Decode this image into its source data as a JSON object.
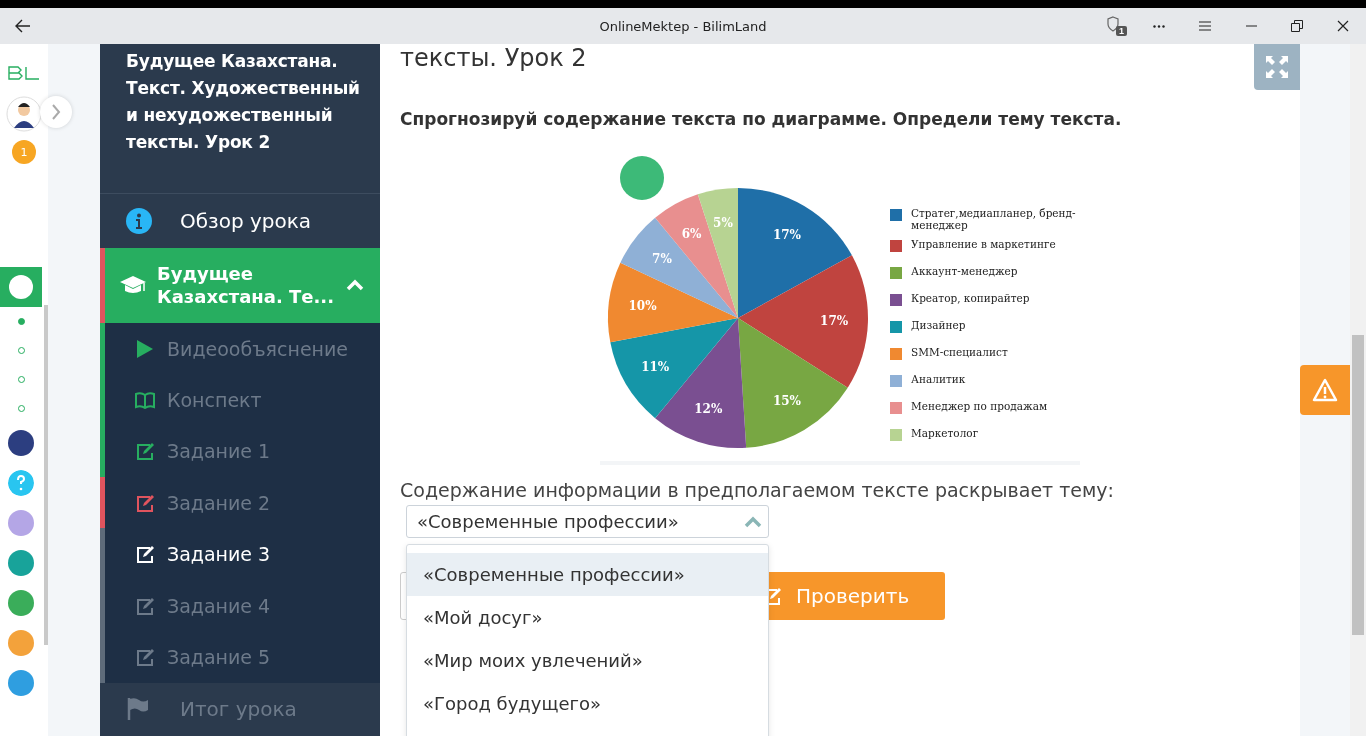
{
  "window": {
    "title": "OnlineMektep - BilimLand",
    "extension_badge": "1"
  },
  "rail": {
    "notification_count": "1",
    "lesson_dots": [
      {
        "selected": true
      },
      {
        "selected": false
      },
      {
        "selected": false
      },
      {
        "selected": false
      }
    ]
  },
  "sidebar": {
    "lesson_title": "Будущее Казахстана. Текст. Художественный и нехудожественный тексты. Урок 2",
    "overview": "Обзор урока",
    "section": {
      "title": "Будущее Казахстана. Те...",
      "expanded": true
    },
    "items": [
      {
        "label": "Видеообъяснение",
        "kind": "video",
        "done": true,
        "failed": false,
        "selected": false
      },
      {
        "label": "Конспект",
        "kind": "notes",
        "done": true,
        "failed": false,
        "selected": false
      },
      {
        "label": "Задание 1",
        "kind": "task",
        "done": true,
        "failed": false,
        "selected": false
      },
      {
        "label": "Задание 2",
        "kind": "task",
        "done": false,
        "failed": true,
        "selected": false
      },
      {
        "label": "Задание 3",
        "kind": "task",
        "done": false,
        "failed": false,
        "selected": true
      },
      {
        "label": "Задание 4",
        "kind": "task",
        "done": false,
        "failed": false,
        "selected": false
      },
      {
        "label": "Задание 5",
        "kind": "task",
        "done": false,
        "failed": false,
        "selected": false
      }
    ],
    "summary": "Итог урока"
  },
  "main": {
    "heading": "тексты. Урок 2",
    "question": "Спрогнозируй содержание текста по диаграмме. Определи тему текста.",
    "chart_data": {
      "type": "pie",
      "data_labels": "value_labels",
      "legend": "right",
      "categories": [
        "Стратег,медиапланер, бренд-менеджер",
        "Управление в маркетинге",
        "Аккаунт-менеджер",
        "Креатор, копирайтер",
        "Дизайнер",
        "SMM-специалист",
        "Аналитик",
        "Менеджер по продажам",
        "Маркетолог"
      ],
      "values": [
        17,
        17,
        15,
        12,
        11,
        10,
        7,
        6,
        5
      ],
      "value_labels": [
        "17%",
        "17%",
        "15%",
        "12%",
        "11%",
        "10%",
        "7%",
        "6%",
        "5%"
      ]
    },
    "prompt": "Содержание информации в предполагаемом тексте раскрывает тему:",
    "select": {
      "value": "«Современные профессии»",
      "expanded": true,
      "options": [
        {
          "label": "«Современные профессии»",
          "selected": true
        },
        {
          "label": "«Мой досуг»",
          "selected": false
        },
        {
          "label": "«Мир моих увлечений»",
          "selected": false
        },
        {
          "label": "«Город будущего»",
          "selected": false
        }
      ]
    },
    "check_button": "Проверить"
  }
}
